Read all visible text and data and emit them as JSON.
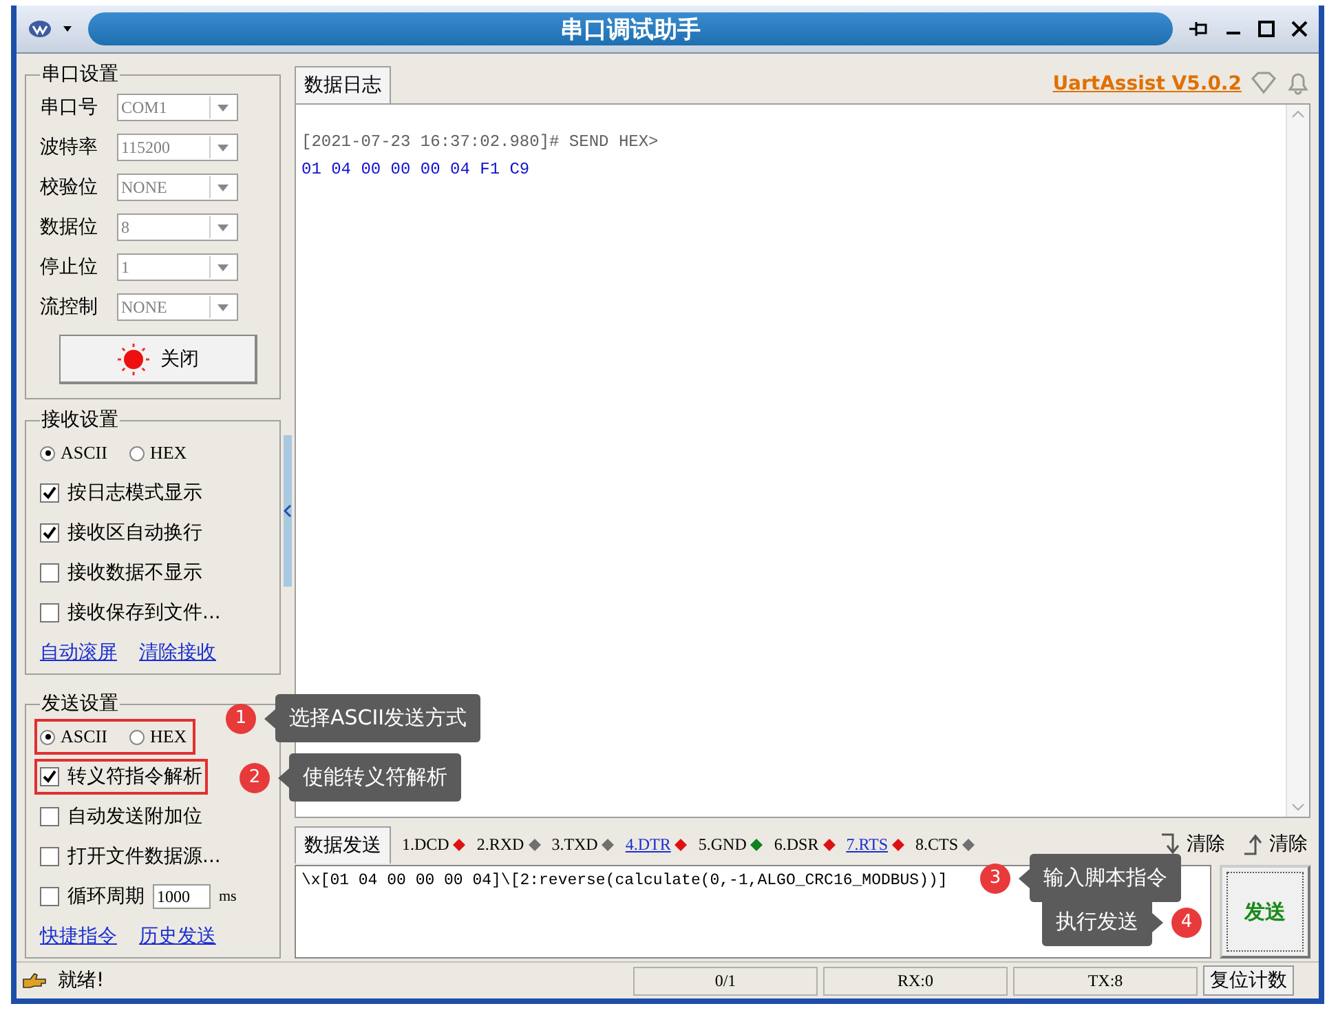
{
  "window": {
    "title": "串口调试助手"
  },
  "serial_settings": {
    "title": "串口设置",
    "fields": [
      {
        "label": "串口号",
        "value": "COM1"
      },
      {
        "label": "波特率",
        "value": "115200"
      },
      {
        "label": "校验位",
        "value": "NONE"
      },
      {
        "label": "数据位",
        "value": "8"
      },
      {
        "label": "停止位",
        "value": "1"
      },
      {
        "label": "流控制",
        "value": "NONE"
      }
    ],
    "toggle_button": {
      "label": "关闭",
      "on": true
    }
  },
  "receive_settings": {
    "title": "接收设置",
    "modes": [
      {
        "label": "ASCII",
        "selected": true
      },
      {
        "label": "HEX",
        "selected": false
      }
    ],
    "options": [
      {
        "label": "按日志模式显示",
        "checked": true
      },
      {
        "label": "接收区自动换行",
        "checked": true
      },
      {
        "label": "接收数据不显示",
        "checked": false
      },
      {
        "label": "接收保存到文件...",
        "checked": false
      }
    ],
    "links": [
      "自动滚屏",
      "清除接收"
    ]
  },
  "send_settings": {
    "title": "发送设置",
    "modes_highlighted": true,
    "modes": [
      {
        "label": "ASCII",
        "selected": true
      },
      {
        "label": "HEX",
        "selected": false
      }
    ],
    "options": [
      {
        "label": "转义符指令解析",
        "checked": true,
        "highlighted": true
      },
      {
        "label": "自动发送附加位",
        "checked": false,
        "highlighted": false
      },
      {
        "label": "打开文件数据源...",
        "checked": false,
        "highlighted": false
      },
      {
        "label": "循环周期",
        "checked": false,
        "highlighted": false,
        "interval": "1000",
        "unit": "ms"
      }
    ],
    "links": [
      "快捷指令",
      "历史发送"
    ]
  },
  "log": {
    "tab": "数据日志",
    "version_link": "UartAssist V5.0.2",
    "lines": [
      {
        "kind": "header",
        "text": "[2021-07-23 16:37:02.980]# SEND HEX>"
      },
      {
        "kind": "data",
        "text": "01 04 00 00 00 04 F1 C9"
      }
    ]
  },
  "send": {
    "tab": "数据发送",
    "signals": [
      {
        "label": "1.DCD",
        "color": "#e01010",
        "link": false
      },
      {
        "label": "2.RXD",
        "color": "#707070",
        "link": false
      },
      {
        "label": "3.TXD",
        "color": "#707070",
        "link": false
      },
      {
        "label": "4.DTR",
        "color": "#e01010",
        "link": true
      },
      {
        "label": "5.GND",
        "color": "#108020",
        "link": false
      },
      {
        "label": "6.DSR",
        "color": "#e01010",
        "link": false
      },
      {
        "label": "7.RTS",
        "color": "#e01010",
        "link": true
      },
      {
        "label": "8.CTS",
        "color": "#707070",
        "link": false
      }
    ],
    "clear_buttons": [
      {
        "kind": "down",
        "label": "清除"
      },
      {
        "kind": "up",
        "label": "清除"
      }
    ],
    "input": "\\x[01 04 00 00 00 04]\\[2:reverse(calculate(0,-1,ALGO_CRC16_MODBUS))]",
    "send_button": "发送"
  },
  "status_bar": {
    "message": "就绪!",
    "cells": [
      "0/1",
      "RX:0",
      "TX:8"
    ],
    "reset_button": "复位计数"
  },
  "annotations": [
    {
      "number": "1",
      "text": "选择ASCII发送方式"
    },
    {
      "number": "2",
      "text": "使能转义符解析"
    },
    {
      "number": "3",
      "text": "输入脚本指令"
    },
    {
      "number": "4",
      "text": "执行发送"
    }
  ]
}
